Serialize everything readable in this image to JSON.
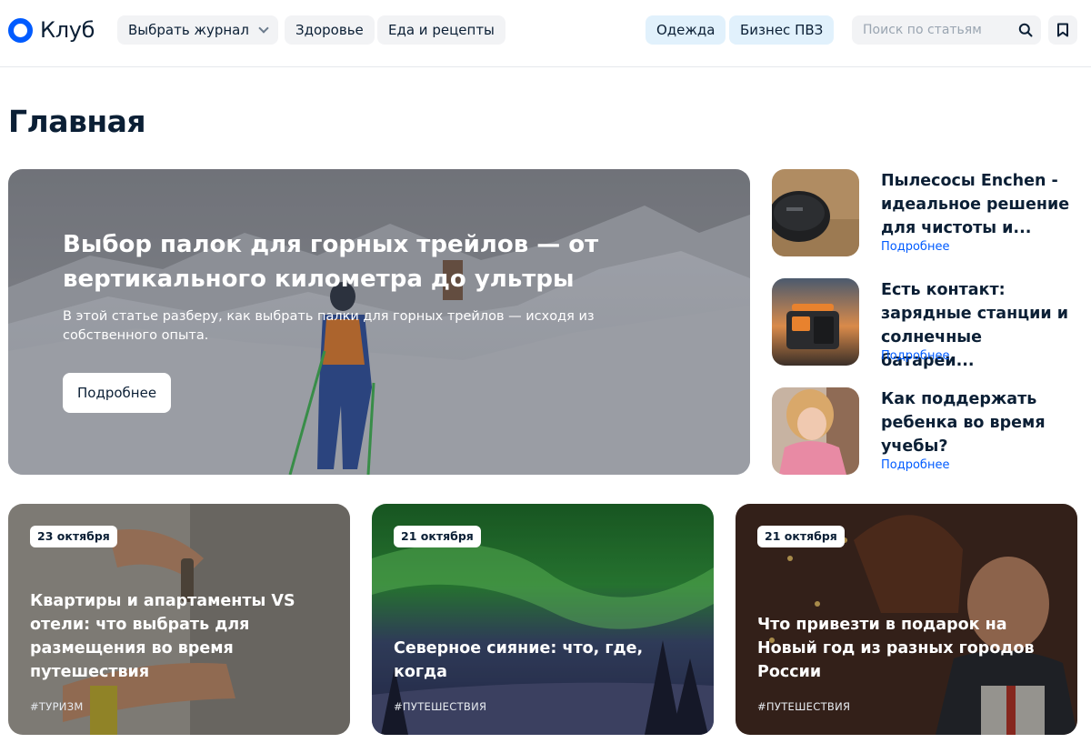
{
  "header": {
    "logo_text": "Клуб",
    "nav": {
      "journal": "Выбрать журнал",
      "health": "Здоровье",
      "food": "Еда и рецепты",
      "clothes": "Одежда",
      "business": "Бизнес ПВЗ"
    },
    "search_placeholder": "Поиск по статьям",
    "icons": {
      "search": "search-icon",
      "bookmark": "bookmark-icon",
      "journal_dropdown": "chevron-down-icon"
    }
  },
  "page_title": "Главная",
  "hero": {
    "title": "Выбор палок для горных трейлов — от вертикального километра до ультры",
    "description": "В этой статье разберу, как выбрать палки для горных трейлов — исходя из собственного опыта.",
    "button": "Подробнее"
  },
  "side_articles": [
    {
      "title": "Пылесосы Enchen - идеальное решение для чистоты и...",
      "more": "Подробнее"
    },
    {
      "title": "Есть контакт: зарядные станции и солнечные батареи...",
      "more": "Подробнее"
    },
    {
      "title": "Как поддержать ребенка во время учебы?",
      "more": "Подробнее"
    }
  ],
  "cards": [
    {
      "date": "23 октября",
      "title": "Квартиры и апартаменты VS отели: что выбрать для размещения во время путешествия",
      "tag": "#ТУРИЗМ"
    },
    {
      "date": "21 октября",
      "title": "Северное сияние: что, где, когда",
      "tag": "#ПУТЕШЕСТВИЯ"
    },
    {
      "date": "21 октября",
      "title": "Что привезти в подарок на Новый год из разных городов России",
      "tag": "#ПУТЕШЕСТВИЯ"
    }
  ],
  "colors": {
    "accent": "#005bff",
    "text": "#0b1f35",
    "pill_gray": "#f2f3f5",
    "pill_blue": "#e1f1fc"
  }
}
